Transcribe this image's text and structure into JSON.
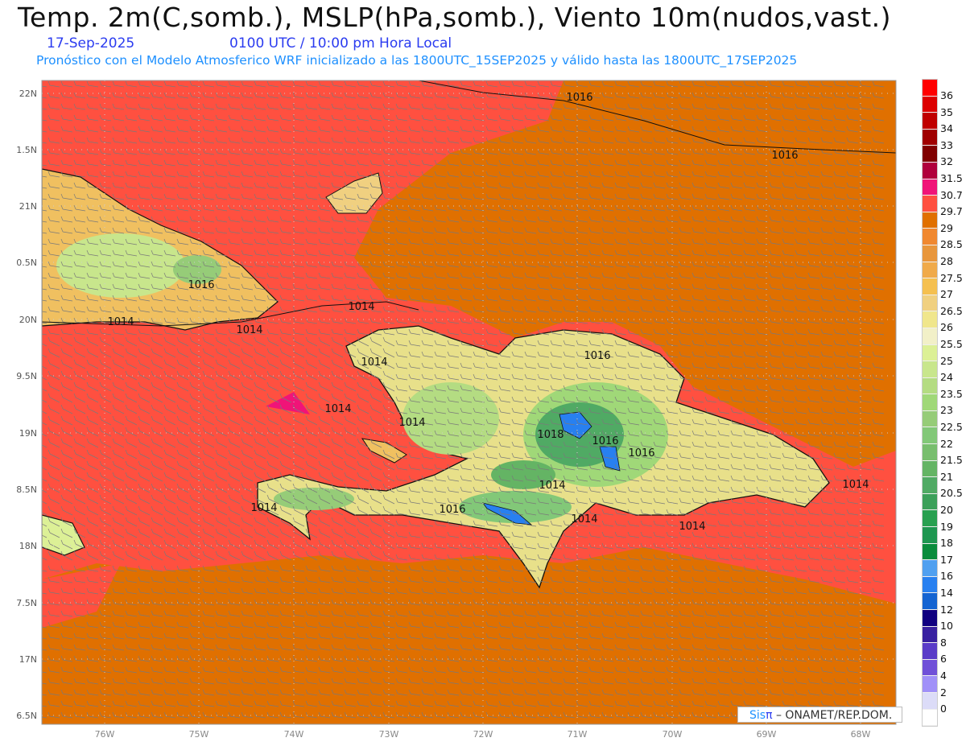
{
  "header": {
    "title": "Temp. 2m(C,somb.), MSLP(hPa,somb.), Viento 10m(nudos,vast.)",
    "date": "17-Sep-2025",
    "time": "0100 UTC / 10:00 pm Hora Local",
    "description": "Pronóstico con el Modelo Atmosferico WRF inicializado a las 1800UTC_15SEP2025 y válido hasta las  1800UTC_17SEP2025"
  },
  "axes": {
    "lat_labels": [
      "22N",
      "1.5N",
      "21N",
      "0.5N",
      "20N",
      "9.5N",
      "19N",
      "8.5N",
      "18N",
      "7.5N",
      "17N",
      "6.5N"
    ],
    "lon_labels": [
      "76W",
      "75W",
      "74W",
      "73W",
      "72W",
      "71W",
      "70W",
      "69W",
      "68W"
    ]
  },
  "isobars": [
    "1016",
    "1016",
    "1016",
    "1014",
    "1014",
    "1014",
    "1014",
    "1014",
    "1014",
    "1016",
    "1018",
    "1016",
    "1016",
    "1014",
    "1014",
    "1014",
    "1014",
    "1014",
    "1016"
  ],
  "colorbar": {
    "labels": [
      "36",
      "35",
      "34",
      "33",
      "32",
      "31.5",
      "30.7",
      "29.7",
      "29",
      "28.5",
      "28",
      "27.5",
      "27",
      "26.5",
      "26",
      "25.5",
      "25",
      "24",
      "23.5",
      "23",
      "22.5",
      "22",
      "21.5",
      "21",
      "20.5",
      "20",
      "19",
      "18",
      "17",
      "16",
      "14",
      "12",
      "10",
      "8",
      "6",
      "4",
      "2",
      "0"
    ],
    "colors": [
      "#ff0000",
      "#dc0000",
      "#c00000",
      "#a00000",
      "#800000",
      "#b0003c",
      "#f01478",
      "#ff5040",
      "#e07000",
      "#f08830",
      "#e8963c",
      "#f0aa4a",
      "#f5c050",
      "#f0d080",
      "#f0e68c",
      "#f2f0c8",
      "#dcf096",
      "#c8e68c",
      "#b4dc82",
      "#a0d878",
      "#96cc78",
      "#82c878",
      "#78be6e",
      "#64b464",
      "#50aa64",
      "#3ca05a",
      "#28a050",
      "#1e9650",
      "#0a8c3c",
      "#50a0f0",
      "#2880f0",
      "#1464d2",
      "#100080",
      "#3820a0",
      "#5a3cc8",
      "#7050d8",
      "#a090f8",
      "#dcdcf8",
      "#ffffff"
    ]
  },
  "credit": {
    "sis": "Sis",
    "pi": "π",
    "org": " – ONAMET/REP.DOM."
  }
}
